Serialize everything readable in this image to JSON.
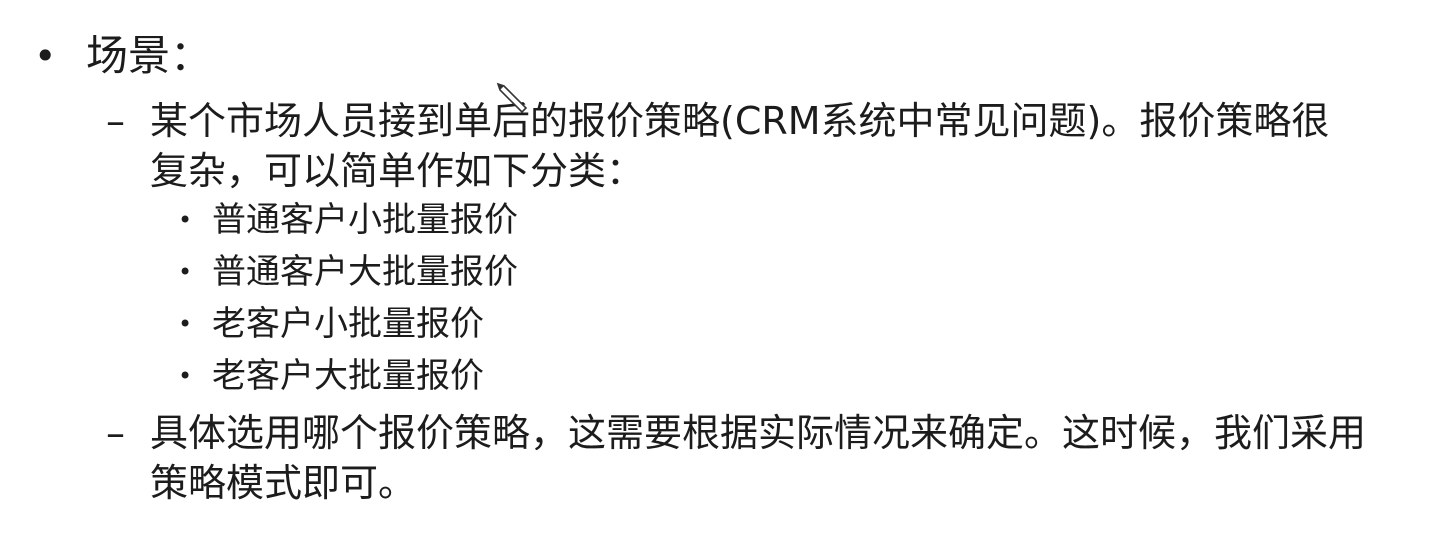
{
  "slide": {
    "heading": "场景：",
    "bullet_symbol": "•",
    "dash_symbol": "–",
    "sub_bullet_symbol": "•",
    "points": [
      {
        "text": "某个市场人员接到单后的报价策略(CRM系统中常见问题)。报价策略很复杂，可以简单作如下分类："
      },
      {
        "text": "具体选用哪个报价策略，这需要根据实际情况来确定。这时候，我们采用策略模式即可。"
      }
    ],
    "sub_items": [
      "普通客户小批量报价",
      "普通客户大批量报价",
      "老客户小批量报价",
      "老客户大批量报价"
    ]
  },
  "icons": {
    "cursor": "pen-cursor-icon"
  }
}
